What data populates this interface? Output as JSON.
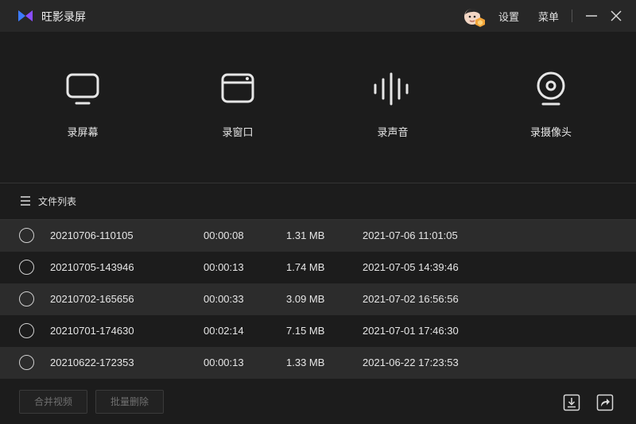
{
  "app": {
    "title": "旺影录屏"
  },
  "titlebar": {
    "settings_label": "设置",
    "menu_label": "菜单"
  },
  "modes": [
    {
      "id": "screen",
      "label": "录屏幕",
      "icon": "monitor-icon"
    },
    {
      "id": "window",
      "label": "录窗口",
      "icon": "window-icon"
    },
    {
      "id": "audio",
      "label": "录声音",
      "icon": "soundwave-icon"
    },
    {
      "id": "camera",
      "label": "录摄像头",
      "icon": "webcam-icon"
    }
  ],
  "file_list": {
    "title": "文件列表",
    "rows": [
      {
        "name": "20210706-110105",
        "duration": "00:00:08",
        "size": "1.31 MB",
        "date": "2021-07-06 11:01:05"
      },
      {
        "name": "20210705-143946",
        "duration": "00:00:13",
        "size": "1.74 MB",
        "date": "2021-07-05 14:39:46"
      },
      {
        "name": "20210702-165656",
        "duration": "00:00:33",
        "size": "3.09 MB",
        "date": "2021-07-02 16:56:56"
      },
      {
        "name": "20210701-174630",
        "duration": "00:02:14",
        "size": "7.15 MB",
        "date": "2021-07-01 17:46:30"
      },
      {
        "name": "20210622-172353",
        "duration": "00:00:13",
        "size": "1.33 MB",
        "date": "2021-06-22 17:23:53"
      }
    ]
  },
  "footer": {
    "merge_label": "合并视频",
    "batch_delete_label": "批量删除"
  },
  "colors": {
    "accent_blue": "#3d7bff",
    "accent_purple": "#8a4dff",
    "background": "#1c1c1c",
    "row_alt": "#2c2c2c"
  }
}
